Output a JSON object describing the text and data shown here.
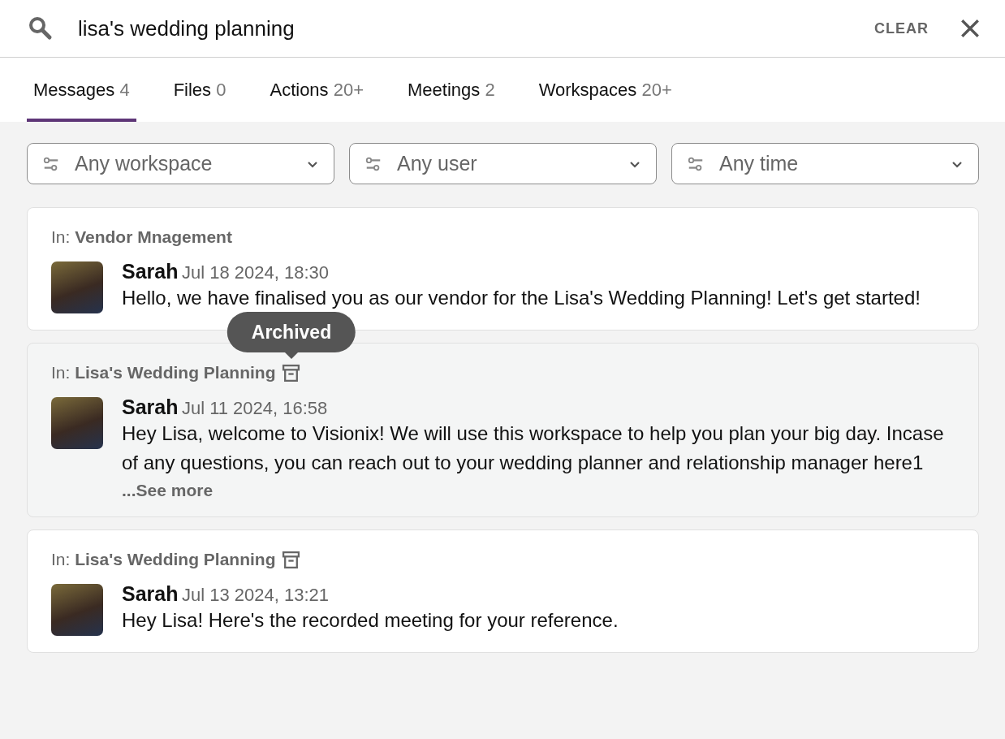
{
  "search": {
    "value": "lisa's wedding planning",
    "clear": "CLEAR"
  },
  "tabs": [
    {
      "label": "Messages",
      "count": "4",
      "selected": true
    },
    {
      "label": "Files",
      "count": "0",
      "selected": false
    },
    {
      "label": "Actions",
      "count": "20+",
      "selected": false
    },
    {
      "label": "Meetings",
      "count": "2",
      "selected": false
    },
    {
      "label": "Workspaces",
      "count": "20+",
      "selected": false
    }
  ],
  "filters": [
    {
      "label": "Any workspace"
    },
    {
      "label": "Any user"
    },
    {
      "label": "Any time"
    }
  ],
  "results": [
    {
      "in_label": "In:",
      "workspace": "Vendor Mnagement",
      "archived": false,
      "highlighted": false,
      "sender": "Sarah",
      "time": "Jul 18 2024, 18:30",
      "text": "Hello, we have finalised you as our vendor for the Lisa's Wedding Planning! Let's get started!"
    },
    {
      "in_label": "In:",
      "workspace": "Lisa's Wedding Planning",
      "archived": true,
      "highlighted": true,
      "tooltip": "Archived",
      "sender": "Sarah",
      "time": "Jul 11 2024, 16:58",
      "text": "Hey Lisa, welcome to Visionix! We will use this workspace to help you plan your big day. Incase of any questions, you can reach out to your wedding planner and relationship manager here1",
      "see_more": "...See more"
    },
    {
      "in_label": "In:",
      "workspace": "Lisa's Wedding Planning",
      "archived": true,
      "highlighted": false,
      "sender": "Sarah",
      "time": "Jul 13 2024, 13:21",
      "text": "Hey Lisa! Here's the recorded meeting for your reference."
    }
  ]
}
